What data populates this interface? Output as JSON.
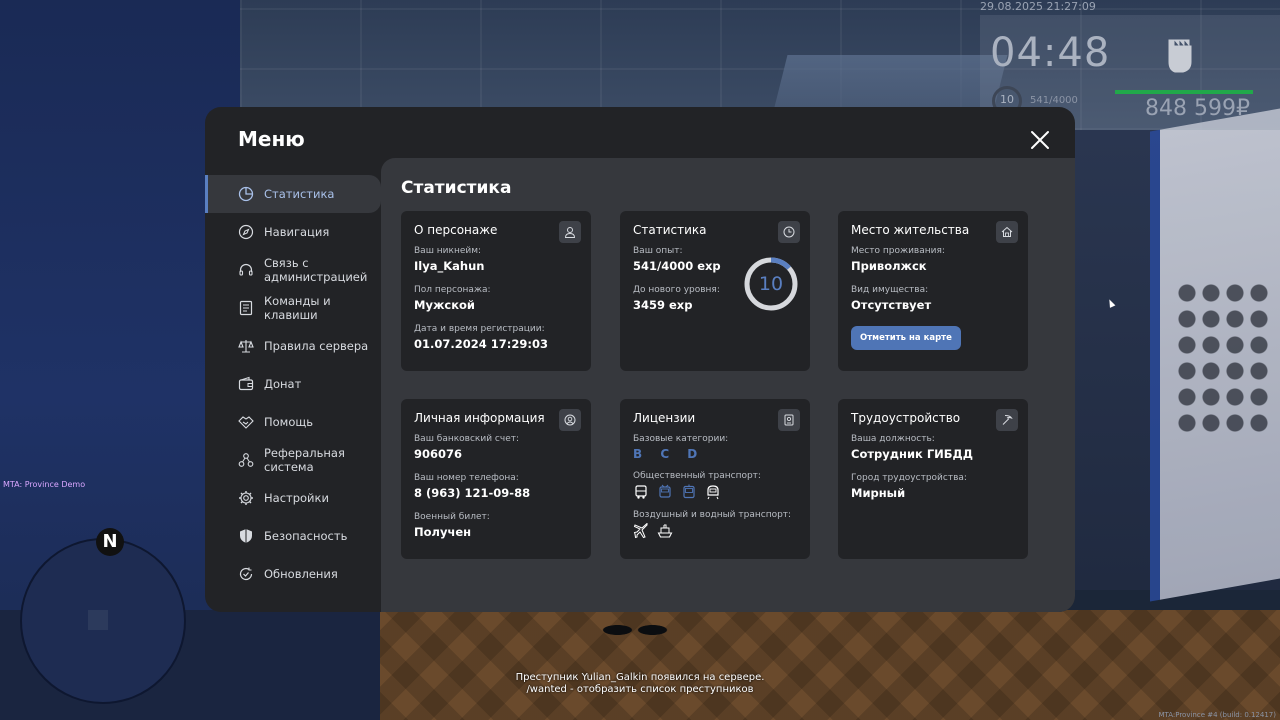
{
  "hud": {
    "datetime": "29.08.2025 21:27:09",
    "clock": "04:48",
    "level": "10",
    "exp": "541/4000",
    "money": "848 599₽",
    "server_name": "MTA: Province Demo",
    "build": "MTA:Province #4 (build: 0.12417)",
    "compass": "N"
  },
  "chat": {
    "line1": "Преступник Yulian_Galkin появился на сервере.",
    "line2": "/wanted - отобразить список преступников"
  },
  "menu": {
    "title": "Меню",
    "sidebar": [
      {
        "label": "Статистика",
        "icon": "pie-chart-icon",
        "active": true
      },
      {
        "label": "Навигация",
        "icon": "compass-icon"
      },
      {
        "label": "Связь с\nадминистрацией",
        "icon": "headset-icon"
      },
      {
        "label": "Команды и\nклавиши",
        "icon": "document-icon"
      },
      {
        "label": "Правила сервера",
        "icon": "scales-icon"
      },
      {
        "label": "Донат",
        "icon": "wallet-icon"
      },
      {
        "label": "Помощь",
        "icon": "handshake-icon"
      },
      {
        "label": "Реферальная\nсистема",
        "icon": "network-icon"
      },
      {
        "label": "Настройки",
        "icon": "gear-icon"
      },
      {
        "label": "Безопасность",
        "icon": "shield-icon"
      },
      {
        "label": "Обновления",
        "icon": "refresh-check-icon"
      }
    ]
  },
  "content": {
    "title": "Статистика",
    "character": {
      "title": "О персонаже",
      "nick_label": "Ваш никнейм:",
      "nick": "Ilya_Kahun",
      "gender_label": "Пол персонажа:",
      "gender": "Мужской",
      "reg_label": "Дата и время регистрации:",
      "reg": "01.07.2024 17:29:03"
    },
    "stats": {
      "title": "Статистика",
      "exp_label": "Ваш опыт:",
      "exp": "541/4000 exp",
      "next_label": "До нового уровня:",
      "next": "3459 exp",
      "level": "10",
      "progress": 0.135
    },
    "residence": {
      "title": "Место жительства",
      "place_label": "Место проживания:",
      "place": "Приволжск",
      "property_label": "Вид имущества:",
      "property": "Отсутствует",
      "button": "Отметить на карте"
    },
    "personal": {
      "title": "Личная информация",
      "bank_label": "Ваш банковский счет:",
      "bank": "906076",
      "phone_label": "Ваш номер телефона:",
      "phone": "8 (963) 121-09-88",
      "military_label": "Военный билет:",
      "military": "Получен"
    },
    "licenses": {
      "title": "Лицензии",
      "base_label": "Базовые категории:",
      "base": "B C D",
      "public_label": "Общественный транспорт:",
      "public_icons": [
        "bus-icon",
        "trolleybus-icon",
        "tram-icon",
        "metro-icon"
      ],
      "airwater_label": "Воздушный и водный транспорт:",
      "airwater_icons": [
        "airplane-icon",
        "ship-icon"
      ]
    },
    "employment": {
      "title": "Трудоустройство",
      "position_label": "Ваша должность:",
      "position": "Сотрудник ГИБДД",
      "city_label": "Город трудоустройства:",
      "city": "Мирный"
    }
  },
  "colors": {
    "accent": "#5a7fc1",
    "button": "#4f75b6",
    "panel": "#222326",
    "content": "#36383d",
    "hud_bar": "#21a84a"
  }
}
